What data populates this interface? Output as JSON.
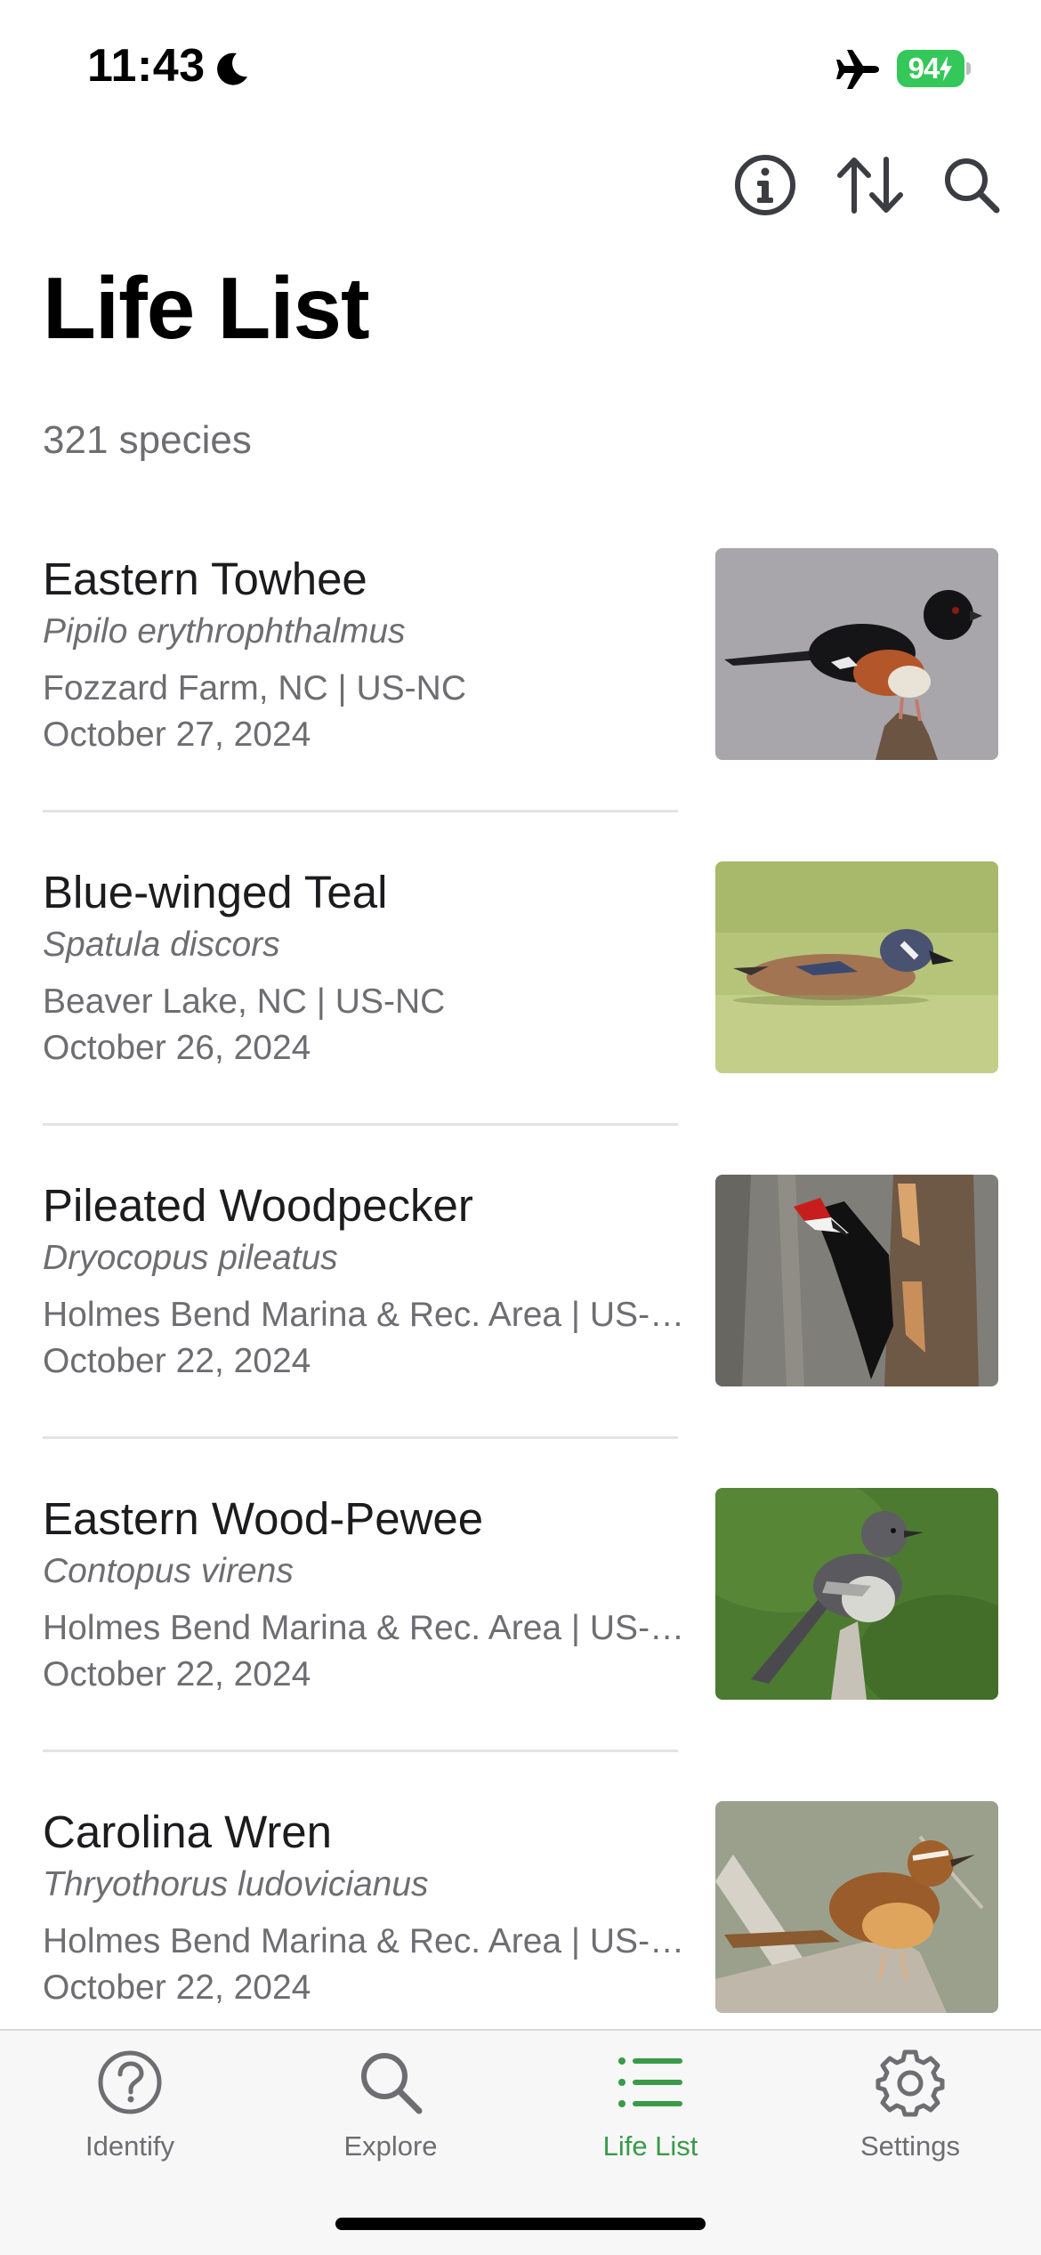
{
  "status_bar": {
    "time": "11:43",
    "battery": "94"
  },
  "toolbar": {
    "icons": [
      "info-icon",
      "sort-icon",
      "search-icon"
    ]
  },
  "header": {
    "title": "Life List",
    "count": "321 species"
  },
  "list": [
    {
      "name": "Eastern Towhee",
      "scientific": "Pipilo erythrophthalmus",
      "location": "Fozzard Farm, NC | US-NC",
      "date": "October 27, 2024"
    },
    {
      "name": "Blue-winged Teal",
      "scientific": "Spatula discors",
      "location": "Beaver Lake, NC | US-NC",
      "date": "October 26, 2024"
    },
    {
      "name": "Pileated Woodpecker",
      "scientific": "Dryocopus pileatus",
      "location": "Holmes Bend Marina & Rec. Area | US-TN",
      "date": "October 22, 2024"
    },
    {
      "name": "Eastern Wood-Pewee",
      "scientific": "Contopus virens",
      "location": "Holmes Bend Marina & Rec. Area | US-TN",
      "date": "October 22, 2024"
    },
    {
      "name": "Carolina Wren",
      "scientific": "Thryothorus ludovicianus",
      "location": "Holmes Bend Marina & Rec. Area | US-TN",
      "date": "October 22, 2024"
    }
  ],
  "tabs": [
    {
      "label": "Identify",
      "icon": "question-circle-icon"
    },
    {
      "label": "Explore",
      "icon": "search-icon"
    },
    {
      "label": "Life List",
      "icon": "list-icon",
      "active": true
    },
    {
      "label": "Settings",
      "icon": "gear-icon"
    }
  ],
  "colors": {
    "accent": "#3a9a49",
    "battery": "#34c759",
    "secondary_text": "#6d6d72"
  }
}
